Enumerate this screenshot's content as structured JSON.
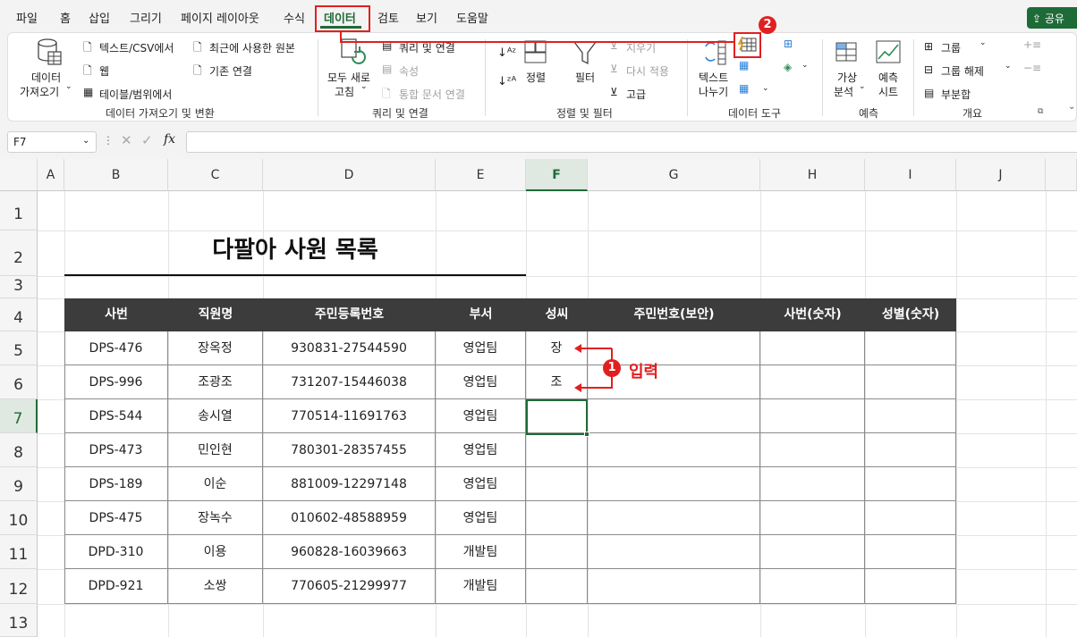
{
  "menu": {
    "items": [
      "파일",
      "홈",
      "삽입",
      "그리기",
      "페이지 레이아웃",
      "수식",
      "데이터",
      "검토",
      "보기",
      "도움말"
    ],
    "active": "데이터",
    "share": "공유"
  },
  "ribbon": {
    "get_data": {
      "label": "데이터\n가져오기",
      "line1": "데이터",
      "line2": "가져오기"
    },
    "text_csv": "텍스트/CSV에서",
    "web": "웹",
    "table_range": "테이블/범위에서",
    "recent_sources": "최근에 사용한 원본",
    "existing_conn": "기존 연결",
    "group_import": "데이터 가져오기 및 변환",
    "refresh_all_1": "모두 새로",
    "refresh_all_2": "고침",
    "queries_conn": "쿼리 및 연결",
    "properties": "속성",
    "edit_links": "통합 문서 연결",
    "group_queries": "쿼리 및 연결",
    "sort": "정렬",
    "filter": "필터",
    "clear": "지우기",
    "reapply": "다시 적용",
    "advanced": "고급",
    "group_sort": "정렬 및 필터",
    "text_to_columns_1": "텍스트",
    "text_to_columns_2": "나누기",
    "group_tools": "데이터 도구",
    "whatif_1": "가상",
    "whatif_2": "분석",
    "forecast_1": "예측",
    "forecast_2": "시트",
    "group_forecast": "예측",
    "group": "그룹",
    "ungroup": "그룹 해제",
    "subtotal": "부분합",
    "group_outline": "개요"
  },
  "formula_bar": {
    "name_box": "F7",
    "fx": "fx",
    "value": ""
  },
  "columns": [
    "A",
    "B",
    "C",
    "D",
    "E",
    "F",
    "G",
    "H",
    "I",
    "J"
  ],
  "rows": [
    "1",
    "2",
    "3",
    "4",
    "5",
    "6",
    "7",
    "8",
    "9",
    "10",
    "11",
    "12",
    "13"
  ],
  "sheet": {
    "title": "다팔아 사원 목록",
    "headers": [
      "사번",
      "직원명",
      "주민등록번호",
      "부서",
      "성씨",
      "주민번호(보안)",
      "사번(숫자)",
      "성별(숫자)"
    ],
    "rows": [
      [
        "DPS-476",
        "장옥정",
        "930831-27544590",
        "영업팀",
        "장",
        "",
        "",
        ""
      ],
      [
        "DPS-996",
        "조광조",
        "731207-15446038",
        "영업팀",
        "조",
        "",
        "",
        ""
      ],
      [
        "DPS-544",
        "송시열",
        "770514-11691763",
        "영업팀",
        "",
        "",
        "",
        ""
      ],
      [
        "DPS-473",
        "민인현",
        "780301-28357455",
        "영업팀",
        "",
        "",
        "",
        ""
      ],
      [
        "DPS-189",
        "이순",
        "881009-12297148",
        "영업팀",
        "",
        "",
        "",
        ""
      ],
      [
        "DPS-475",
        "장녹수",
        "010602-48588959",
        "영업팀",
        "",
        "",
        "",
        ""
      ],
      [
        "DPD-310",
        "이용",
        "960828-16039663",
        "개발팀",
        "",
        "",
        "",
        ""
      ],
      [
        "DPD-921",
        "소쌍",
        "770605-21299977",
        "개발팀",
        "",
        "",
        "",
        ""
      ]
    ]
  },
  "annotations": {
    "step1_number": "1",
    "step1_label": "입력",
    "step2_number": "2"
  },
  "colors": {
    "accent": "#1e6b38",
    "annotation": "#e02020",
    "table_header": "#3c3c3c"
  }
}
